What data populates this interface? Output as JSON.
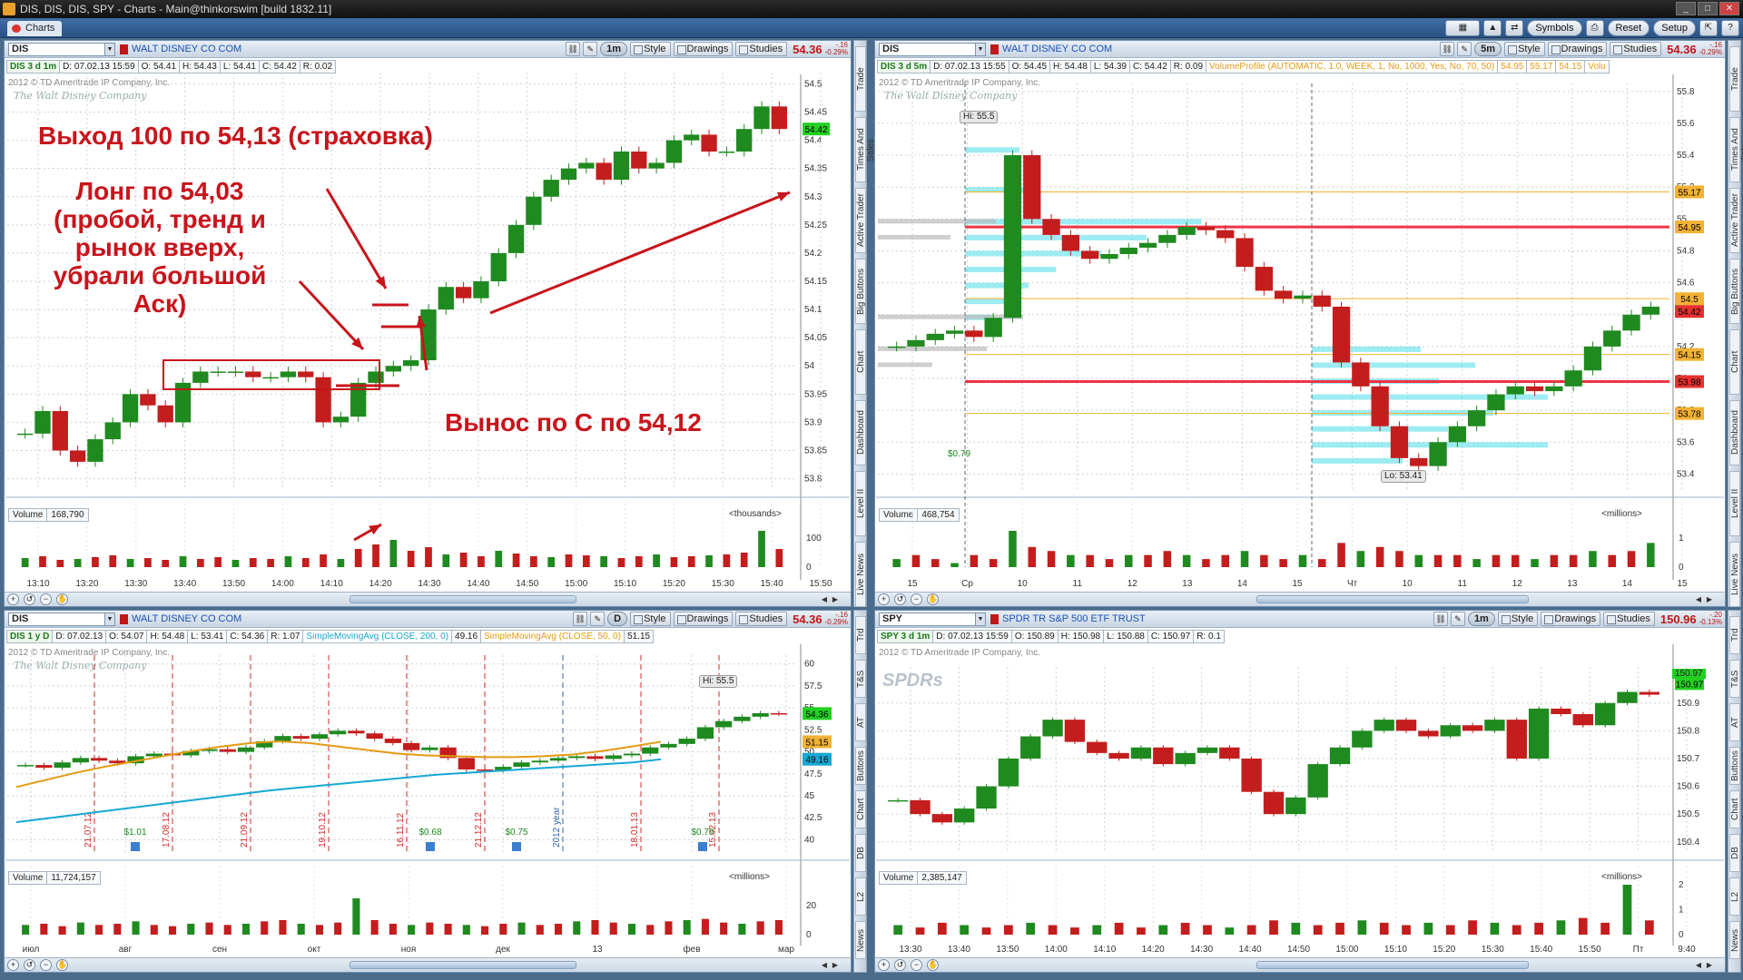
{
  "window": {
    "title": "DIS, DIS, DIS, SPY - Charts - Main@thinkorswim [build 1832.11]"
  },
  "app": {
    "tab": "Charts",
    "buttons": [
      "Symbols",
      "Reset",
      "Setup"
    ]
  },
  "sidebar": {
    "items": [
      "Trade",
      "Times And Sales",
      "Active Trader",
      "Big Buttons",
      "Chart",
      "Dashboard",
      "Level II",
      "Live News"
    ],
    "items2": [
      "Trd",
      "T&S",
      "AT",
      "Buttons",
      "Chart",
      "DB",
      "L2",
      "News"
    ]
  },
  "panels": [
    {
      "symbol": "DIS",
      "description": "WALT DISNEY CO COM",
      "timeframe": "1m",
      "style": "Style",
      "drawings": "Drawings",
      "studies": "Studies",
      "price": "54.36",
      "change": "-.16",
      "change_pct": "-0.29%",
      "info": {
        "label": "DIS 3 d 1m",
        "date": "D: 07.02.13 15:59",
        "open": "O: 54.41",
        "high": "H: 54.43",
        "low": "L: 54.41",
        "close": "C: 54.42",
        "range": "R: 0.02"
      },
      "copyright": "2012 © TD Ameritrade IP Company, Inc.",
      "logo": "The Walt Disney Company",
      "last_tag": "54.42",
      "volume": {
        "label": "Volume",
        "value": "168,790",
        "unit": "<thousands>"
      }
    },
    {
      "symbol": "DIS",
      "description": "WALT DISNEY CO COM",
      "timeframe": "5m",
      "style": "Style",
      "drawings": "Drawings",
      "studies": "Studies",
      "price": "54.36",
      "change": "-.16",
      "change_pct": "-0.29%",
      "info": {
        "label": "DIS 3 d 5m",
        "date": "D: 07.02.13 15:55",
        "open": "O: 54.45",
        "high": "H: 54.48",
        "low": "L: 54.39",
        "close": "C: 54.42",
        "range": "R: 0.09",
        "study": "VolumeProfile (AUTOMATIC, 1.0, WEEK, 1, No, 1000, Yes, No, 70, 50)",
        "v1": "54.95",
        "v2": "55.17",
        "v3": "54.15",
        "v4": "Volu"
      },
      "copyright": "2012 © TD Ameritrade IP Company, Inc.",
      "logo": "The Walt Disney Company",
      "hi_label": "Hi: 55.5",
      "lo_label": "Lo: 53.41",
      "div_label": "$0.79",
      "volume": {
        "label": "Volume",
        "value": "468,754",
        "unit": "<millions>"
      }
    },
    {
      "symbol": "DIS",
      "description": "WALT DISNEY CO COM",
      "timeframe": "D",
      "style": "Style",
      "drawings": "Drawings",
      "studies": "Studies",
      "price": "54.36",
      "change": "-.16",
      "change_pct": "-0.29%",
      "info": {
        "label": "DIS 1 y D",
        "date": "D: 07.02.13",
        "open": "O: 54.07",
        "high": "H: 54.48",
        "low": "L: 53.41",
        "close": "C: 54.36",
        "range": "R: 1.07",
        "sma200": "SimpleMovingAvg (CLOSE, 200, 0)",
        "sma200v": "49.16",
        "sma50": "SimpleMovingAvg (CLOSE, 50, 0)",
        "sma50v": "51.15"
      },
      "copyright": "2012 © TD Ameritrade IP Company, Inc.",
      "logo": "The Walt Disney Company",
      "hi_label": "Hi: 55.5",
      "volume": {
        "label": "Volume",
        "value": "11,724,157",
        "unit": "<millions>"
      }
    },
    {
      "symbol": "SPY",
      "description": "SPDR TR S&P 500 ETF TRUST",
      "timeframe": "1m",
      "style": "Style",
      "drawings": "Drawings",
      "studies": "Studies",
      "price": "150.96",
      "change": "-.20",
      "change_pct": "-0.13%",
      "info": {
        "label": "SPY 3 d 1m",
        "date": "D: 07.02.13 15:59",
        "open": "O: 150.89",
        "high": "H: 150.98",
        "low": "L: 150.88",
        "close": "C: 150.97",
        "range": "R: 0.1"
      },
      "copyright": "2012 © TD Ameritrade IP Company, Inc.",
      "logo": "SPDRs",
      "last_tag": "150.97",
      "volume": {
        "label": "Volume",
        "value": "2,385,147",
        "unit": "<millions>"
      }
    }
  ],
  "annotations": {
    "exit": "Выход 100 по 54,13 (страховка)",
    "long": [
      "Лонг по 54,03",
      "(пробой, тренд и",
      "рынок вверх,",
      "убрали большой",
      "Аск)"
    ],
    "stop": "Вынос по С по 54,12"
  },
  "chart_data": [
    {
      "type": "candlestick",
      "title": "DIS 3 d 1m",
      "x_ticks": [
        "13:10",
        "13:20",
        "13:30",
        "13:40",
        "13:50",
        "14:00",
        "14:10",
        "14:20",
        "14:30",
        "14:40",
        "14:50",
        "15:00",
        "15:10",
        "15:20",
        "15:30",
        "15:40",
        "15:50"
      ],
      "y_ticks": [
        "54.5",
        "54.45",
        "54.4",
        "54.35",
        "54.3",
        "54.25",
        "54.2",
        "54.15",
        "54.1",
        "54.05",
        "54",
        "53.95",
        "53.9",
        "53.85",
        "53.8"
      ],
      "ylim": [
        53.78,
        54.52
      ],
      "close": [
        53.88,
        53.92,
        53.85,
        53.83,
        53.87,
        53.9,
        53.95,
        53.93,
        53.9,
        53.97,
        53.99,
        53.99,
        53.99,
        53.98,
        53.98,
        53.99,
        53.98,
        53.9,
        53.91,
        53.97,
        53.99,
        54.0,
        54.01,
        54.1,
        54.14,
        54.12,
        54.15,
        54.2,
        54.25,
        54.3,
        54.33,
        54.35,
        54.36,
        54.33,
        54.38,
        54.35,
        54.36,
        54.4,
        54.41,
        54.38,
        54.38,
        54.42,
        54.46,
        54.42
      ],
      "volume_ticks": [
        "100",
        "0"
      ],
      "volume": [
        10,
        12,
        8,
        9,
        11,
        13,
        9,
        10,
        8,
        12,
        9,
        11,
        8,
        10,
        9,
        12,
        10,
        14,
        9,
        20,
        25,
        30,
        18,
        22,
        14,
        16,
        12,
        18,
        15,
        12,
        11,
        14,
        13,
        12,
        10,
        12,
        14,
        11,
        12,
        13,
        14,
        16,
        40,
        20
      ]
    },
    {
      "type": "candlestick",
      "title": "DIS 3 d 5m",
      "study": "VolumeProfile",
      "x_ticks": [
        "15",
        "Ср",
        "10",
        "11",
        "12",
        "13",
        "14",
        "15",
        "Чт",
        "10",
        "11",
        "12",
        "13",
        "14",
        "15"
      ],
      "y_ticks": [
        "55.8",
        "55.6",
        "55.4",
        "55.2",
        "55",
        "54.8",
        "54.6",
        "54.4",
        "54.2",
        "54",
        "53.8",
        "53.6",
        "53.4"
      ],
      "ylim": [
        53.3,
        55.85
      ],
      "price_tags": [
        "55.17",
        "54.95",
        "54.5",
        "54.42",
        "54.15",
        "53.98",
        "53.78"
      ],
      "close": [
        54.2,
        54.24,
        54.28,
        54.3,
        54.26,
        54.38,
        55.4,
        55.0,
        54.9,
        54.8,
        54.75,
        54.78,
        54.82,
        54.85,
        54.9,
        54.95,
        54.93,
        54.88,
        54.7,
        54.55,
        54.5,
        54.52,
        54.45,
        54.1,
        53.95,
        53.7,
        53.5,
        53.45,
        53.6,
        53.7,
        53.8,
        53.9,
        53.95,
        53.92,
        53.95,
        54.05,
        54.2,
        54.3,
        54.4,
        54.45
      ],
      "volume_ticks": [
        "1",
        "0"
      ],
      "volume": [
        0.2,
        0.3,
        0.2,
        0.1,
        0.3,
        0.2,
        0.9,
        0.5,
        0.4,
        0.3,
        0.3,
        0.2,
        0.3,
        0.3,
        0.4,
        0.3,
        0.2,
        0.3,
        0.4,
        0.3,
        0.2,
        0.3,
        0.2,
        0.6,
        0.4,
        0.5,
        0.4,
        0.3,
        0.3,
        0.3,
        0.2,
        0.3,
        0.3,
        0.2,
        0.3,
        0.3,
        0.4,
        0.3,
        0.4,
        0.6
      ]
    },
    {
      "type": "candlestick",
      "title": "DIS 1 y D",
      "x_ticks": [
        "июл",
        "авг",
        "сен",
        "окт",
        "ноя",
        "дек",
        "13",
        "фев",
        "мар"
      ],
      "y_ticks": [
        "60",
        "57.5",
        "55",
        "52.5",
        "50",
        "47.5",
        "45",
        "42.5",
        "40"
      ],
      "ylim": [
        38.5,
        61
      ],
      "series": [
        {
          "name": "SimpleMovingAvg (CLOSE, 200, 0)",
          "color": "#16a8d2"
        },
        {
          "name": "SimpleMovingAvg (CLOSE, 50, 0)",
          "color": "#e39a14"
        }
      ],
      "price_tags": [
        "54.36",
        "51.15",
        "49.16"
      ],
      "event_dates": [
        "21.07.12",
        "17.08.12",
        "21.09.12",
        "19.10.12",
        "16.11.12",
        "21.12.12",
        "2012 year",
        "18.01.13",
        "15.02.13"
      ],
      "dividends": [
        "$1.01",
        "$0.68",
        "$0.75",
        "$0.79"
      ],
      "close": [
        48.5,
        48.2,
        48.8,
        49.3,
        49.0,
        48.7,
        49.5,
        49.8,
        49.6,
        50.1,
        50.3,
        50.0,
        50.5,
        51.2,
        51.8,
        51.5,
        52.0,
        52.4,
        52.1,
        51.5,
        51.0,
        50.2,
        50.5,
        49.3,
        48.0,
        47.9,
        48.3,
        48.8,
        49.0,
        49.3,
        49.5,
        49.2,
        49.6,
        49.8,
        50.5,
        50.9,
        51.5,
        52.8,
        53.5,
        54.0,
        54.4,
        54.36
      ],
      "sma200": [
        42.0,
        42.4,
        42.8,
        43.2,
        43.6,
        44.0,
        44.4,
        44.8,
        45.2,
        45.6,
        45.9,
        46.2,
        46.5,
        46.8,
        47.1,
        47.4,
        47.6,
        47.8,
        48.0,
        48.2,
        48.4,
        48.6,
        48.8,
        49.16
      ],
      "sma50": [
        46.0,
        46.8,
        47.6,
        48.3,
        48.9,
        49.5,
        50.1,
        50.6,
        51.0,
        51.2,
        51.0,
        50.6,
        50.2,
        49.8,
        49.6,
        49.5,
        49.4,
        49.4,
        49.5,
        49.7,
        50.1,
        50.6,
        51.15
      ],
      "volume_ticks": [
        "20",
        "0"
      ],
      "volume": [
        8,
        9,
        7,
        10,
        8,
        9,
        11,
        8,
        7,
        9,
        10,
        8,
        9,
        11,
        12,
        9,
        8,
        10,
        30,
        12,
        9,
        8,
        10,
        9,
        8,
        7,
        9,
        10,
        8,
        9,
        11,
        12,
        10,
        9,
        8,
        11,
        12,
        13,
        10,
        9,
        11,
        12
      ]
    },
    {
      "type": "candlestick",
      "title": "SPY 3 d 1m",
      "x_ticks": [
        "13:30",
        "13:40",
        "13:50",
        "14:00",
        "14:10",
        "14:20",
        "14:30",
        "14:40",
        "14:50",
        "15:00",
        "15:10",
        "15:20",
        "15:30",
        "15:40",
        "15:50",
        "Пт",
        "9:40"
      ],
      "y_ticks": [
        "150.9",
        "150.8",
        "150.7",
        "150.6",
        "150.5",
        "150.4"
      ],
      "ylim": [
        150.36,
        151.03
      ],
      "price_tags": [
        "150.97"
      ],
      "close": [
        150.55,
        150.5,
        150.47,
        150.52,
        150.6,
        150.7,
        150.78,
        150.84,
        150.76,
        150.72,
        150.7,
        150.74,
        150.68,
        150.72,
        150.74,
        150.7,
        150.58,
        150.5,
        150.56,
        150.68,
        150.74,
        150.8,
        150.84,
        150.8,
        150.78,
        150.82,
        150.8,
        150.84,
        150.7,
        150.88,
        150.86,
        150.82,
        150.9,
        150.94,
        150.93
      ],
      "volume_ticks": [
        "2",
        "1",
        "0"
      ],
      "volume": [
        0.4,
        0.3,
        0.5,
        0.4,
        0.3,
        0.4,
        0.5,
        0.4,
        0.3,
        0.4,
        0.5,
        0.3,
        0.4,
        0.5,
        0.4,
        0.3,
        0.4,
        0.6,
        0.5,
        0.4,
        0.5,
        0.6,
        0.5,
        0.4,
        0.5,
        0.4,
        0.6,
        0.5,
        0.4,
        0.5,
        0.6,
        0.7,
        0.5,
        2.1,
        0.6
      ]
    }
  ]
}
